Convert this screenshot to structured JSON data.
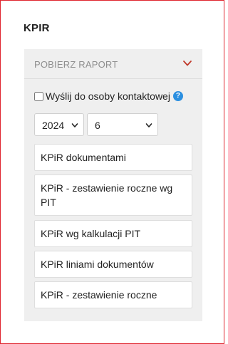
{
  "section": {
    "title": "KPIR"
  },
  "panel": {
    "header_label": "POBIERZ RAPORT",
    "header_icon": "chevron-down-icon"
  },
  "options": {
    "send_to_contact_label": "Wyślij do osoby kontaktowej",
    "send_to_contact_checked": false,
    "help_icon": "question-icon",
    "help_glyph": "?",
    "year_value": "2024",
    "month_value": "6"
  },
  "reports": [
    {
      "label": "KPiR dokumentami"
    },
    {
      "label": "KPiR - zestawienie roczne wg PIT"
    },
    {
      "label": "KPiR wg kalkulacji PIT"
    },
    {
      "label": "KPiR liniami dokumentów"
    },
    {
      "label": "KPiR - zestawienie roczne"
    }
  ],
  "colors": {
    "frame_border": "#e0252f",
    "chevron": "#c0392b",
    "help_icon_bg": "#2b8fe0",
    "panel_bg": "#efefef"
  }
}
